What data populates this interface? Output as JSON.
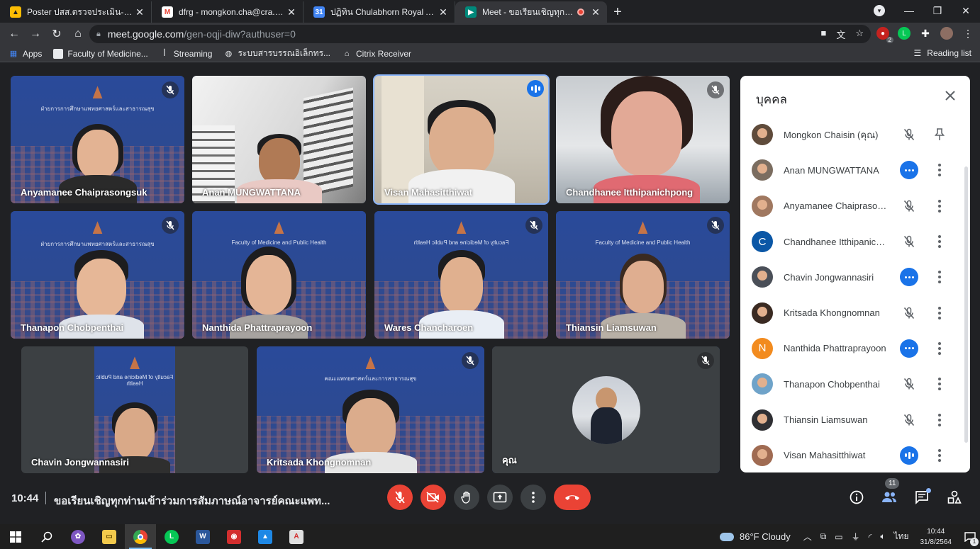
{
  "browser": {
    "tabs": [
      {
        "title": "Poster ปสส.ตรวจประเมิน-คณะแพทย์...",
        "favicon": "drive-icon",
        "favicon_color": "#fbbc04"
      },
      {
        "title": "dfrg - mongkon.cha@cra.ac.th - ...",
        "favicon": "gmail-icon",
        "favicon_color": "#ea4335"
      },
      {
        "title": "ปฏิทิน Chulabhorn Royal Academy...",
        "favicon": "calendar-icon",
        "favicon_color": "#4285f4"
      },
      {
        "title": "Meet - ขอเรียนเชิญทุกท่านเข้าร่ว",
        "favicon": "meet-icon",
        "favicon_color": "#00897b",
        "active": true
      }
    ],
    "url_host": "meet.google.com",
    "url_path": "/gen-oqji-diw?authuser=0",
    "extension_badge": "2",
    "bookmarks": [
      {
        "label": "Apps",
        "icon": "apps-grid-icon"
      },
      {
        "label": "Faculty of Medicine...",
        "icon": "page-icon"
      },
      {
        "label": "Streaming",
        "icon": "streaming-icon"
      },
      {
        "label": "ระบบสารบรรณอิเล็กทร...",
        "icon": "globe-icon"
      },
      {
        "label": "Citrix Receiver",
        "icon": "citrix-icon"
      }
    ],
    "reading_list": "Reading list"
  },
  "meeting": {
    "time": "10:44",
    "title": "ขอเรียนเชิญทุกท่านเข้าร่วมการสัมภาษณ์อาจารย์คณะแพท...",
    "participant_count": "11",
    "tiles": [
      {
        "name": "Anyamanee Chaiprasongsuk",
        "muted": true,
        "speaking": false,
        "bg": "blue",
        "caption": "ฝ่ายการการศึกษาแพทยศาสตร์และสาธารณสุข",
        "caption_dir": "normal"
      },
      {
        "name": "Anan MUNGWATTANA",
        "muted": false,
        "speaking": false,
        "bg": "white",
        "caption": "",
        "caption_dir": "normal"
      },
      {
        "name": "Visan Mahasitthiwat",
        "muted": false,
        "speaking": true,
        "bg": "room",
        "caption": "",
        "caption_dir": "normal"
      },
      {
        "name": "Chandhanee Itthipanichpong",
        "muted": true,
        "speaking": false,
        "bg": "wall",
        "caption": "",
        "caption_dir": "normal"
      },
      {
        "name": "Thanapon Chobpenthai",
        "muted": true,
        "speaking": false,
        "bg": "blue",
        "caption": "ฝ่ายการการศึกษาแพทยศาสตร์และสาธารณสุข",
        "caption_dir": "normal"
      },
      {
        "name": "Nanthida Phattraprayoon",
        "muted": false,
        "speaking": false,
        "bg": "blue",
        "caption": "Faculty of Medicine and Public Health",
        "caption_dir": "normal"
      },
      {
        "name": "Wares Chancharoen",
        "muted": true,
        "speaking": false,
        "bg": "blue",
        "caption": "Faculty of Medicine and Public Health",
        "caption_dir": "mirror"
      },
      {
        "name": "Thiansin Liamsuwan",
        "muted": true,
        "speaking": false,
        "bg": "blue",
        "caption": "Faculty of Medicine and Public Health",
        "caption_dir": "normal"
      },
      {
        "name": "Chavin Jongwannasiri",
        "muted": false,
        "speaking": false,
        "bg": "blue",
        "caption": "Faculty of Medicine and Public Health",
        "caption_dir": "mirror"
      },
      {
        "name": "Kritsada Khongnomnan",
        "muted": true,
        "speaking": false,
        "bg": "blue",
        "caption": "คณะแพทยศาสตร์และการสาธารณสุข",
        "caption_dir": "normal"
      },
      {
        "name": "คุณ",
        "muted": true,
        "speaking": false,
        "bg": "gray",
        "caption": "",
        "caption_dir": "normal"
      }
    ]
  },
  "people_panel": {
    "heading": "บุคคล",
    "participants": [
      {
        "name": "Mongkon Chaisin (คุณ)",
        "status": "muted",
        "extra": "pin",
        "avatar_color": "#5f4b3b",
        "initial": ""
      },
      {
        "name": "Anan MUNGWATTANA",
        "status": "dots",
        "extra": "more",
        "avatar_color": "#7b6d60",
        "initial": ""
      },
      {
        "name": "Anyamanee Chaiprasongsuk",
        "status": "muted",
        "extra": "more",
        "avatar_color": "#a07860",
        "initial": ""
      },
      {
        "name": "Chandhanee Itthipanichpong",
        "status": "muted",
        "extra": "more",
        "avatar_color": "#0b57a6",
        "initial": "C"
      },
      {
        "name": "Chavin Jongwannasiri",
        "status": "dots",
        "extra": "more",
        "avatar_color": "#4a4f58",
        "initial": ""
      },
      {
        "name": "Kritsada Khongnomnan",
        "status": "muted",
        "extra": "more",
        "avatar_color": "#3a2a22",
        "initial": ""
      },
      {
        "name": "Nanthida Phattraprayoon",
        "status": "dots",
        "extra": "more",
        "avatar_color": "#f28b1f",
        "initial": "N"
      },
      {
        "name": "Thanapon Chobpenthai",
        "status": "muted",
        "extra": "more",
        "avatar_color": "#6fa3c9",
        "initial": ""
      },
      {
        "name": "Thiansin Liamsuwan",
        "status": "muted",
        "extra": "more",
        "avatar_color": "#2f2f33",
        "initial": ""
      },
      {
        "name": "Visan Mahasitthiwat",
        "status": "bars",
        "extra": "more",
        "avatar_color": "#a06b52",
        "initial": ""
      }
    ]
  },
  "taskbar": {
    "weather": "86°F  Cloudy",
    "lang": "ไทย",
    "time": "10:44",
    "date": "31/8/2564",
    "notifications": "1"
  }
}
